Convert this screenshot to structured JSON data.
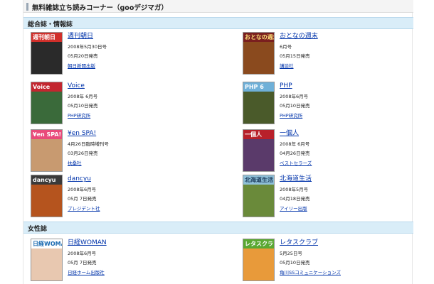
{
  "header": {
    "title": "無料雑誌立ち読みコーナー（gooデジマガ）"
  },
  "sections": [
    {
      "label": "総合誌・情報誌",
      "items": [
        {
          "title": "週刊朝日",
          "issue": "2008年5月30日号",
          "date": "05月20日発売",
          "publisher": "朝日新聞出版",
          "cover": {
            "masthead": "週刊朝日",
            "band": "#d12f2a",
            "text": "#ffffff",
            "art": "#2a2a2a"
          }
        },
        {
          "title": "おとなの週末",
          "issue": "6月号",
          "date": "05月15日発売",
          "publisher": "講談社",
          "cover": {
            "masthead": "おとなの週末",
            "band": "#7a1f1f",
            "text": "#ffe07a",
            "art": "#8a4a1e"
          }
        },
        {
          "title": "Voice",
          "issue": "2008年 6月号",
          "date": "05月10日発売",
          "publisher": "PHP研究所",
          "cover": {
            "masthead": "Voice",
            "band": "#c3262f",
            "text": "#ffffff",
            "art": "#3a6a3a"
          }
        },
        {
          "title": "PHP",
          "issue": "2008年6月号",
          "date": "05月10日発売",
          "publisher": "PHP研究所",
          "cover": {
            "masthead": "PHP 6",
            "band": "#6fb0d8",
            "text": "#ffffff",
            "art": "#4a5a2a"
          }
        },
        {
          "title": "¥en SPA!",
          "issue": "4月26日臨時増刊号",
          "date": "03月26日発売",
          "publisher": "扶桑社",
          "cover": {
            "masthead": "¥en SPA!",
            "band": "#e94a7a",
            "text": "#ffffff",
            "art": "#c89a70"
          }
        },
        {
          "title": "一個人",
          "issue": "2008年 6月号",
          "date": "04月26日発売",
          "publisher": "ベストセラーズ",
          "cover": {
            "masthead": "一個人",
            "band": "#b8202a",
            "text": "#ffffff",
            "art": "#5a3a6a"
          }
        },
        {
          "title": "dancyu",
          "issue": "2008年6月号",
          "date": "05月 7日発売",
          "publisher": "プレジデント社",
          "cover": {
            "masthead": "dancyu",
            "band": "#3a3a3a",
            "text": "#ffffff",
            "art": "#b5541e"
          }
        },
        {
          "title": "北海道生活",
          "issue": "2008年5月号",
          "date": "04月18日発売",
          "publisher": "アイリー出版",
          "cover": {
            "masthead": "北海道生活",
            "band": "#8fc0d8",
            "text": "#1a3a5a",
            "art": "#6a8a3a"
          }
        }
      ]
    },
    {
      "label": "女性誌",
      "items": [
        {
          "title": "日経WOMAN",
          "issue": "2008年6月号",
          "date": "05月 7日発売",
          "publisher": "日経ホーム出版社",
          "cover": {
            "masthead": "日経WOMAN",
            "band": "#ffffff",
            "text": "#1a6ab0",
            "art": "#e8c8b0"
          }
        },
        {
          "title": "レタスクラブ",
          "issue": "5月25日号",
          "date": "05月10日発売",
          "publisher": "角川SSコミュニケーションズ",
          "cover": {
            "masthead": "レタスクラブ",
            "band": "#5aa832",
            "text": "#ffffff",
            "art": "#e89a3a"
          }
        }
      ]
    }
  ]
}
